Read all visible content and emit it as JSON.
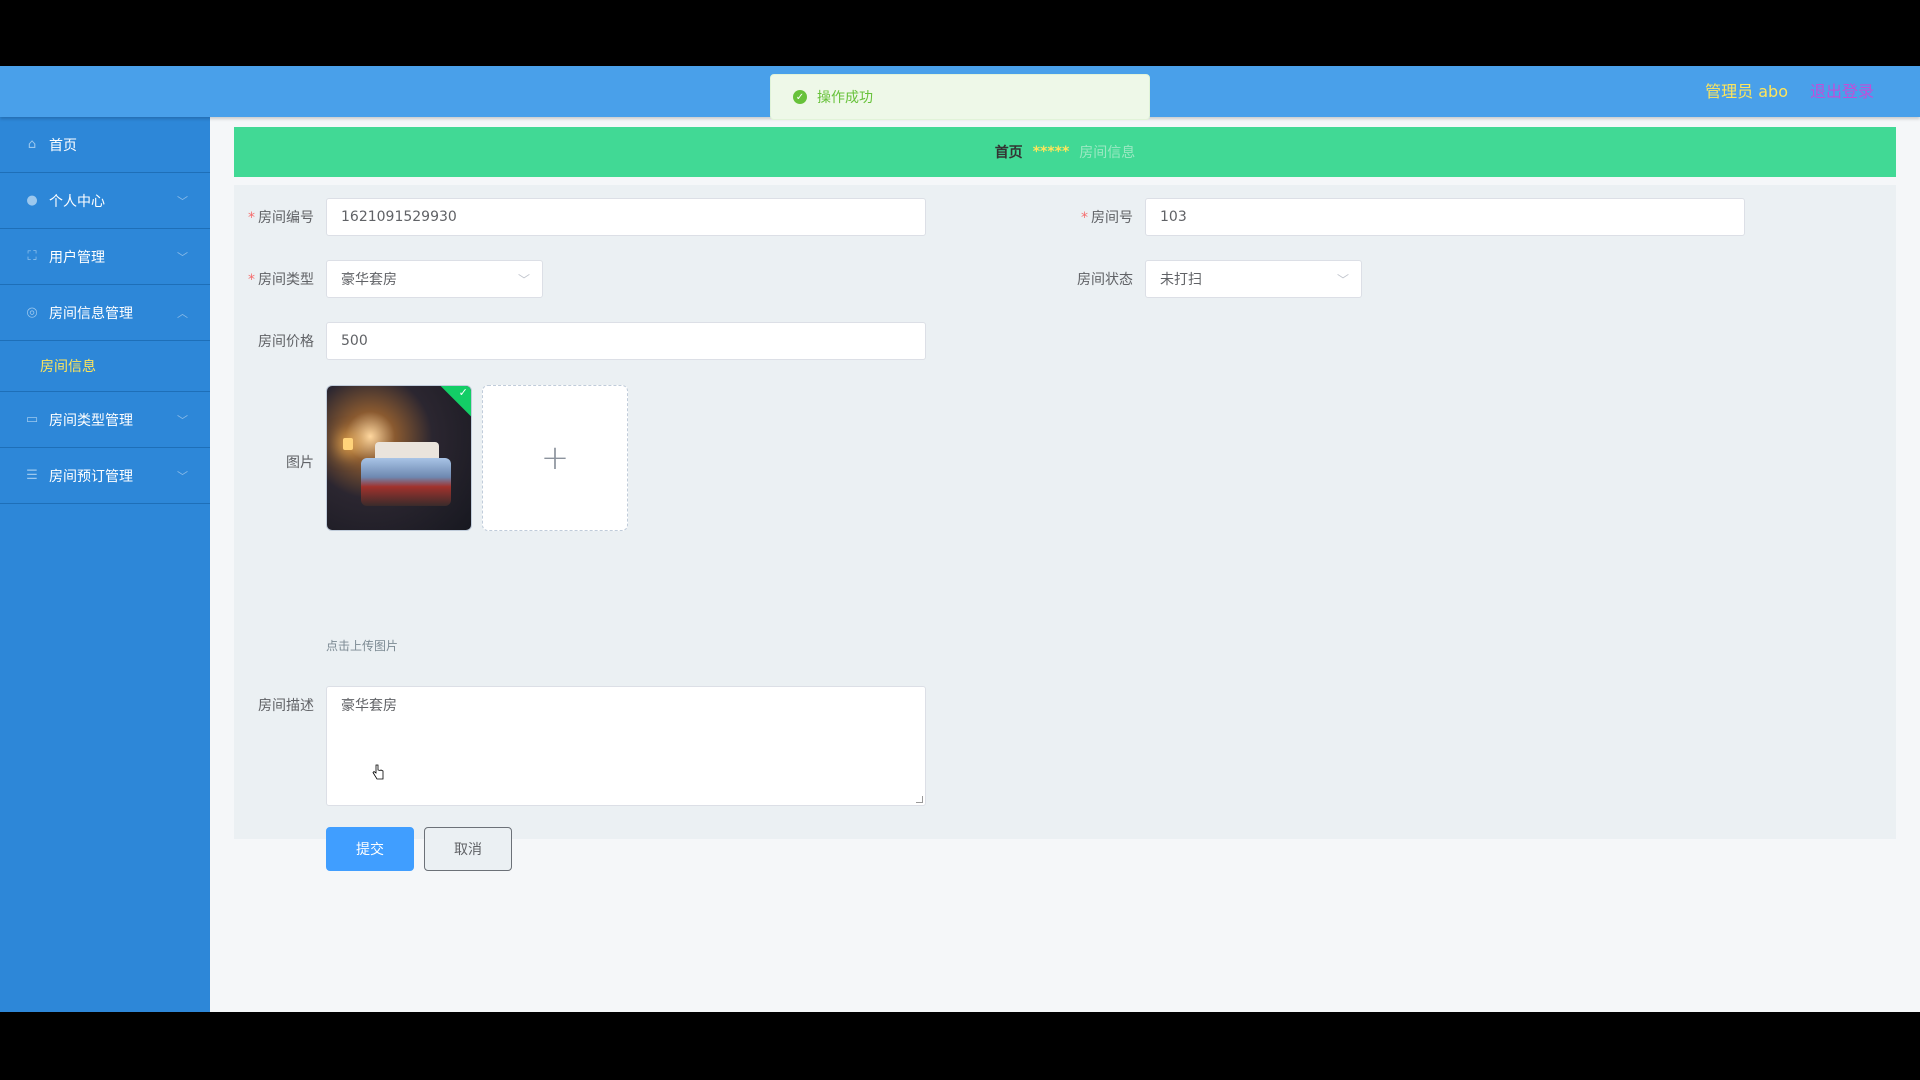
{
  "header": {
    "user": "管理员 abo",
    "logout": "退出登录"
  },
  "toast": {
    "message": "操作成功",
    "icon": "check-circle-icon",
    "color": "#67c23a"
  },
  "sidebar": {
    "items": [
      {
        "label": "首页",
        "icon": "home-icon"
      },
      {
        "label": "个人中心",
        "icon": "user-icon"
      },
      {
        "label": "用户管理",
        "icon": "frame-icon"
      },
      {
        "label": "房间信息管理",
        "icon": "globe-icon"
      },
      {
        "label": "房间类型管理",
        "icon": "chat-icon"
      },
      {
        "label": "房间预订管理",
        "icon": "sliders-icon"
      }
    ],
    "submenu": {
      "label": "房间信息"
    }
  },
  "breadcrumb": {
    "home": "首页",
    "separator": "*****",
    "current": "房间信息"
  },
  "form": {
    "room_code": {
      "label": "房间编号",
      "value": "1621091529930"
    },
    "room_no": {
      "label": "房间号",
      "value": "103"
    },
    "room_type": {
      "label": "房间类型",
      "value": "豪华套房"
    },
    "room_status": {
      "label": "房间状态",
      "value": "未打扫"
    },
    "price": {
      "label": "房间价格",
      "value": "500"
    },
    "image": {
      "label": "图片",
      "hint": "点击上传图片"
    },
    "description": {
      "label": "房间描述",
      "value": "豪华套房"
    },
    "submit_label": "提交",
    "cancel_label": "取消"
  },
  "colors": {
    "header": "#49a0ea",
    "sidebar": "#2d87d8",
    "breadcrumb": "#41d995",
    "accent_yellow": "#ffe55a",
    "primary_button": "#409eff"
  }
}
